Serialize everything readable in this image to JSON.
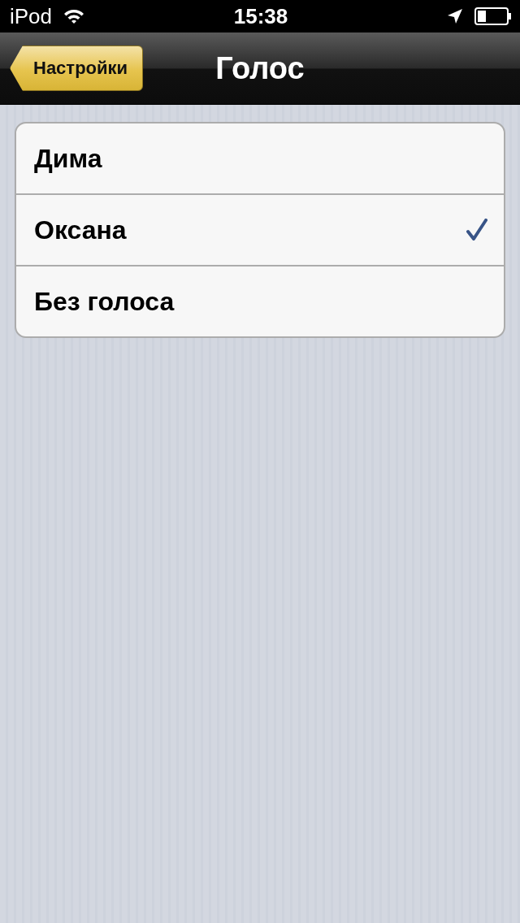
{
  "status_bar": {
    "device": "iPod",
    "time": "15:38"
  },
  "nav_bar": {
    "back_button": "Настройки",
    "title": "Голос"
  },
  "voices": [
    {
      "label": "Дима",
      "selected": false
    },
    {
      "label": "Оксана",
      "selected": true
    },
    {
      "label": "Без голоса",
      "selected": false
    }
  ]
}
